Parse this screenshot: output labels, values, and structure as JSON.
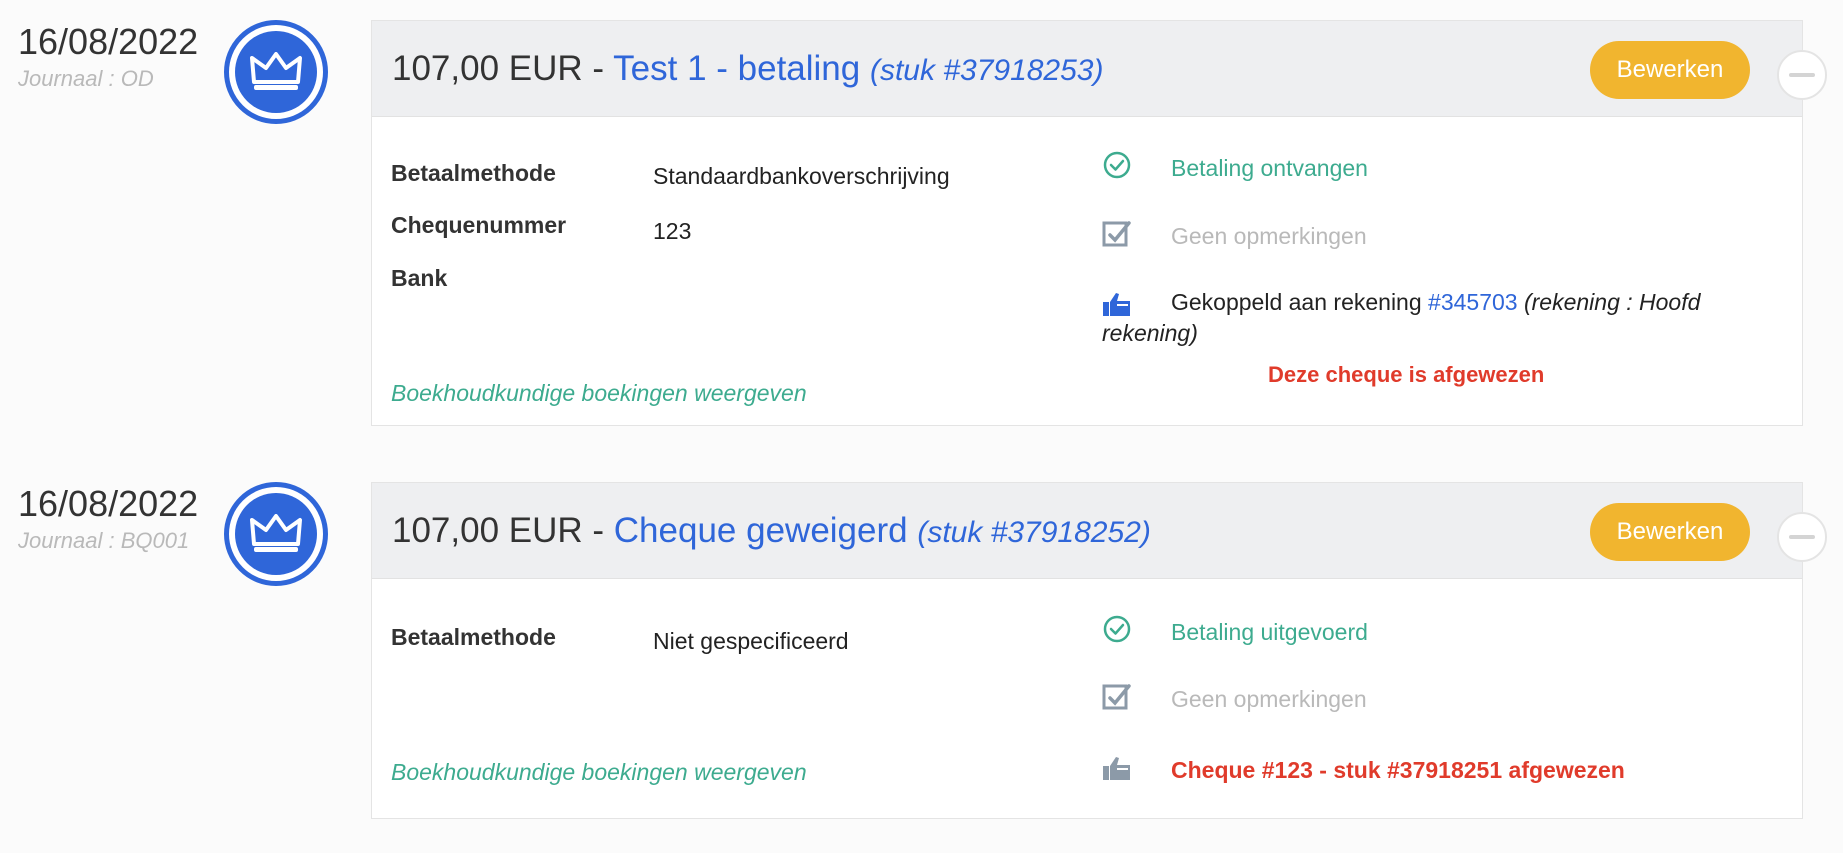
{
  "entries": [
    {
      "date": "16/08/2022",
      "journal": "Journaal : OD",
      "amount": "107,00 EUR",
      "separator": " - ",
      "title": "Test 1 - betaling",
      "piece": "(stuk #37918253)",
      "edit_label": "Bewerken",
      "fields": [
        {
          "label": "Betaalmethode",
          "value": "Standaardbankoverschrijving"
        },
        {
          "label": "Chequenummer",
          "value": "123"
        },
        {
          "label": "Bank",
          "value": ""
        }
      ],
      "status": "Betaling ontvangen",
      "remarks": "Geen opmerkingen",
      "linked_prefix": "Gekoppeld aan rekening ",
      "linked_account": "#345703",
      "linked_suffix": " (rekening : Hoofd rekening)",
      "rejected_note": "Deze cheque is afgewezen",
      "bookings_link": "Boekhoudkundige boekingen weergeven"
    },
    {
      "date": "16/08/2022",
      "journal": "Journaal : BQ001",
      "amount": "107,00 EUR",
      "separator": " - ",
      "title": "Cheque geweigerd",
      "piece": "(stuk #37918252)",
      "edit_label": "Bewerken",
      "fields": [
        {
          "label": "Betaalmethode",
          "value": "Niet gespecificeerd"
        }
      ],
      "status": "Betaling uitgevoerd",
      "remarks": "Geen opmerkingen",
      "rejected_text": "Cheque #123 - stuk #37918251 afgewezen",
      "bookings_link": "Boekhoudkundige boekingen weergeven"
    }
  ],
  "colors": {
    "accent_blue": "#2f66d9",
    "button_yellow": "#f1b52f",
    "status_green": "#3dab8f",
    "muted_grey": "#b9b9b9",
    "alert_red": "#e03b2b"
  },
  "icons": [
    "crown-icon",
    "check-circle-icon",
    "edit-note-icon",
    "thumbs-up-icon",
    "minus-icon"
  ]
}
